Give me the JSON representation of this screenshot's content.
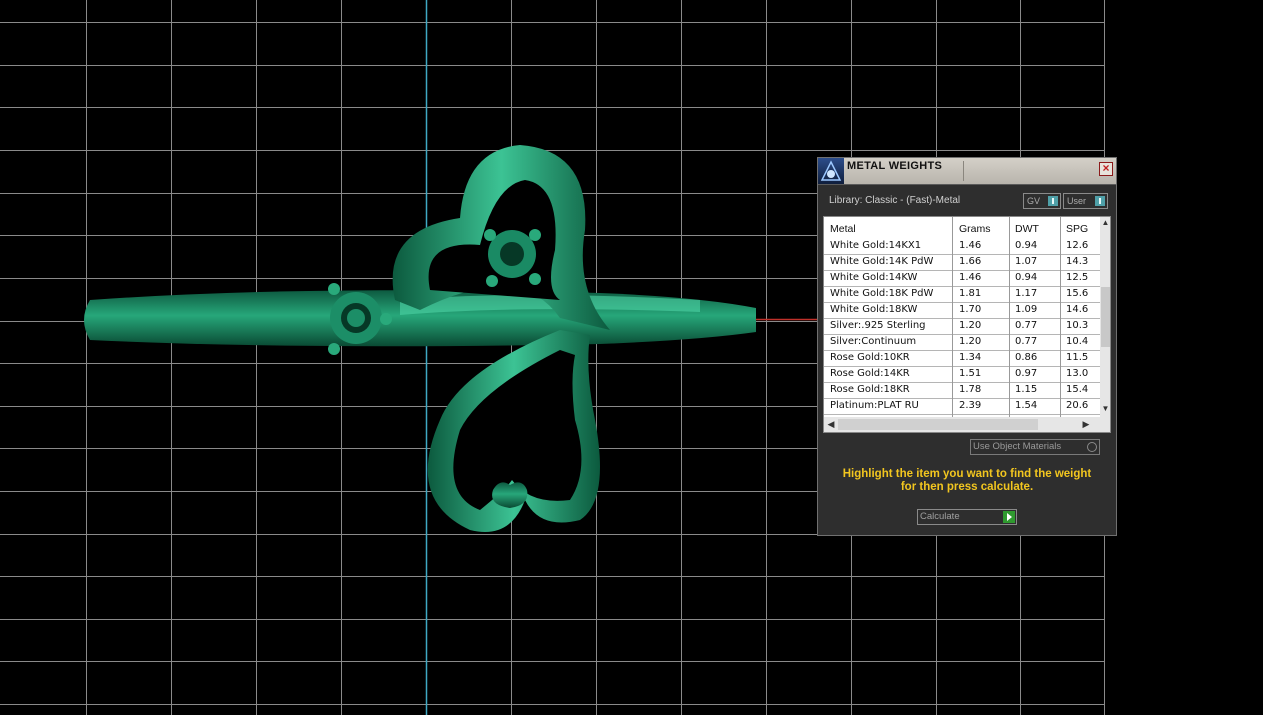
{
  "dialog": {
    "title": "METAL WEIGHTS",
    "close_label": "×",
    "library_label": "Library: Classic - (Fast)-Metal",
    "gv_label": "GV",
    "user_label": "User",
    "use_object_materials_label": "Use Object Materials",
    "hint_line1": "Highlight the item you want to find the weight",
    "hint_line2": "for then press calculate.",
    "calculate_label": "Calculate"
  },
  "table": {
    "headers": [
      "Metal",
      "Grams",
      "DWT",
      "SPG"
    ],
    "rows": [
      [
        "White Gold:14KX1",
        "1.46",
        "0.94",
        "12.6"
      ],
      [
        "White Gold:14K PdW",
        "1.66",
        "1.07",
        "14.3"
      ],
      [
        "White Gold:14KW",
        "1.46",
        "0.94",
        "12.5"
      ],
      [
        "White Gold:18K PdW",
        "1.81",
        "1.17",
        "15.6"
      ],
      [
        "White Gold:18KW",
        "1.70",
        "1.09",
        "14.6"
      ],
      [
        "Silver:.925 Sterling",
        "1.20",
        "0.77",
        "10.3"
      ],
      [
        "Silver:Continuum",
        "1.20",
        "0.77",
        "10.4"
      ],
      [
        "Rose Gold:10KR",
        "1.34",
        "0.86",
        "11.5"
      ],
      [
        "Rose Gold:14KR",
        "1.51",
        "0.97",
        "13.0"
      ],
      [
        "Rose Gold:18KR",
        "1.78",
        "1.15",
        "15.4"
      ],
      [
        "Platinum:PLAT RU",
        "2.39",
        "1.54",
        "20.6"
      ]
    ]
  },
  "colors": {
    "model": "#1f8f6a",
    "grid": "#8a8a8a",
    "axis_y": "#3fa9c4",
    "axis_x": "#c0302a",
    "hint": "#f2c61f"
  },
  "icons": [
    "app-icon",
    "close-icon",
    "toggle-icon",
    "radio-icon",
    "play-icon",
    "scroll-up-icon",
    "scroll-down-icon",
    "scroll-left-icon",
    "scroll-right-icon"
  ]
}
